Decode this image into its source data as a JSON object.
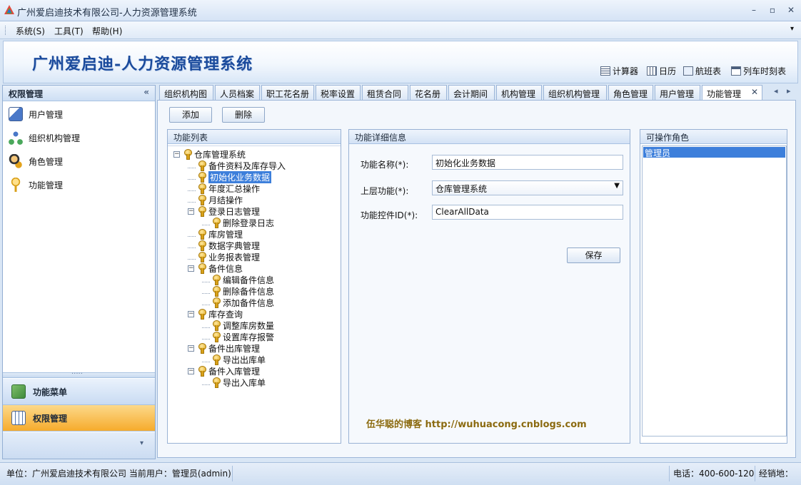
{
  "window": {
    "title": "广州爱启迪技术有限公司-人力资源管理系统",
    "minimize": "–",
    "maximize": "▫",
    "close": "✕"
  },
  "menu": {
    "items": [
      "系统(S)",
      "工具(T)",
      "帮助(H)"
    ],
    "overflow": "▾"
  },
  "banner": {
    "title": "广州爱启迪-人力资源管理系统",
    "tools": [
      {
        "label": "计算器",
        "icon": "calculator-icon"
      },
      {
        "label": "日历",
        "icon": "calendar-icon"
      },
      {
        "label": "航班表",
        "icon": "flight-icon"
      },
      {
        "label": "列车时刻表",
        "icon": "train-icon"
      }
    ]
  },
  "left": {
    "header": "权限管理",
    "collapse": "«",
    "items": [
      {
        "label": "用户管理",
        "icon": "user-card-icon"
      },
      {
        "label": "组织机构管理",
        "icon": "org-chart-icon"
      },
      {
        "label": "角色管理",
        "icon": "role-icon"
      },
      {
        "label": "功能管理",
        "icon": "key-icon"
      }
    ],
    "nav": [
      {
        "label": "功能菜单",
        "icon": "function-menu-icon"
      },
      {
        "label": "权限管理",
        "icon": "permission-grid-icon"
      }
    ],
    "more": "▾",
    "splitter": "·····"
  },
  "tabs": {
    "items": [
      "组织机构图",
      "人员档案",
      "职工花名册",
      "税率设置",
      "租赁合同",
      "花名册",
      "会计期间",
      "机构管理",
      "组织机构管理",
      "角色管理",
      "用户管理",
      "功能管理"
    ],
    "active_index": 11,
    "close": "✕",
    "prev": "◂",
    "next": "▸"
  },
  "toolbar": {
    "add": "添加",
    "delete": "删除"
  },
  "function_list": {
    "title": "功能列表",
    "tree": [
      {
        "label": "仓库管理系统",
        "level": 0,
        "expander": "⊟"
      },
      {
        "label": "备件资料及库存导入",
        "level": 1
      },
      {
        "label": "初始化业务数据",
        "level": 1,
        "selected": true
      },
      {
        "label": "年度汇总操作",
        "level": 1
      },
      {
        "label": "月结操作",
        "level": 1
      },
      {
        "label": "登录日志管理",
        "level": 1,
        "expander": "⊟"
      },
      {
        "label": "删除登录日志",
        "level": 2
      },
      {
        "label": "库房管理",
        "level": 1
      },
      {
        "label": "数据字典管理",
        "level": 1
      },
      {
        "label": "业务报表管理",
        "level": 1
      },
      {
        "label": "备件信息",
        "level": 1,
        "expander": "⊟"
      },
      {
        "label": "编辑备件信息",
        "level": 2
      },
      {
        "label": "删除备件信息",
        "level": 2
      },
      {
        "label": "添加备件信息",
        "level": 2
      },
      {
        "label": "库存查询",
        "level": 1,
        "expander": "⊟"
      },
      {
        "label": "调整库房数量",
        "level": 2
      },
      {
        "label": "设置库存报警",
        "level": 2
      },
      {
        "label": "备件出库管理",
        "level": 1,
        "expander": "⊟"
      },
      {
        "label": "导出出库单",
        "level": 2
      },
      {
        "label": "备件入库管理",
        "level": 1,
        "expander": "⊟"
      },
      {
        "label": "导出入库单",
        "level": 2
      }
    ]
  },
  "detail": {
    "title": "功能详细信息",
    "name_label": "功能名称(*):",
    "name_value": "初始化业务数据",
    "parent_label": "上层功能(*):",
    "parent_value": "仓库管理系统",
    "control_label": "功能控件ID(*):",
    "control_value": "ClearAllData",
    "save": "保存",
    "watermark": "伍华聪的博客 http://wuhuacong.cnblogs.com"
  },
  "roles": {
    "title": "可操作角色",
    "items": [
      "管理员"
    ]
  },
  "status": {
    "left": "单位：广州爱启迪技术有限公司 当前用户：管理员(admin)",
    "phone": "电话：400-600-120",
    "manager": "经销地："
  },
  "colors": {
    "accent": "#3d7fdb",
    "nav_active": "#f8b136",
    "banner_title": "#1a4a9c"
  }
}
